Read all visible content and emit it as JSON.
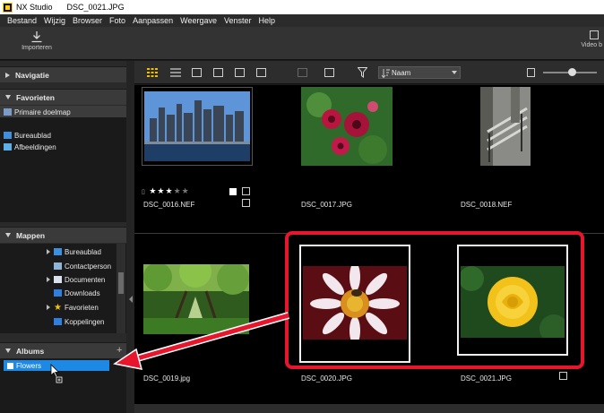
{
  "window": {
    "app_name": "NX Studio",
    "file_name": "DSC_0021.JPG"
  },
  "menu": [
    "Bestand",
    "Wijzig",
    "Browser",
    "Foto",
    "Aanpassen",
    "Weergave",
    "Venster",
    "Help"
  ],
  "toolbar": {
    "import_label": "Importeren",
    "video_label": "Video b"
  },
  "sidebar": {
    "navigation": {
      "title": "Navigatie"
    },
    "favorites": {
      "title": "Favorieten",
      "items": [
        "Primaire doelmap",
        "Bureaublad",
        "Afbeeldingen"
      ]
    },
    "folders": {
      "title": "Mappen",
      "items": [
        "Bureaublad",
        "Contactperson",
        "Documenten",
        "Downloads",
        "Favorieten",
        "Koppelingen"
      ]
    },
    "albums": {
      "title": "Albums",
      "items": [
        "Flowers"
      ],
      "add_symbol": "+"
    }
  },
  "viewbar": {
    "sort_label": "Naam"
  },
  "thumbnails": [
    {
      "file": "DSC_0016.NEF",
      "rating": 3
    },
    {
      "file": "DSC_0017.JPG"
    },
    {
      "file": "DSC_0018.NEF"
    },
    {
      "file": "DSC_0019.jpg"
    },
    {
      "file": "DSC_0020.JPG"
    },
    {
      "file": "DSC_0021.JPG"
    }
  ],
  "colors": {
    "accent_blue": "#1e88e5",
    "highlight_red": "#e8162d",
    "background": "#000000"
  },
  "icons": [
    "download-icon",
    "film-icon",
    "grid-view-icon",
    "list-view-icon",
    "filter-icon",
    "sort-icon",
    "folder-icon",
    "star-icon",
    "album-icon"
  ]
}
